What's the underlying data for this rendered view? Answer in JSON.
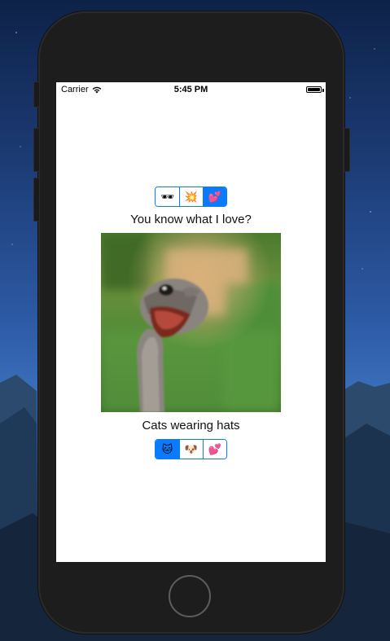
{
  "status_bar": {
    "carrier": "Carrier",
    "time": "5:45 PM",
    "battery_level": 1.0
  },
  "top_segmented_control": {
    "segments": [
      {
        "icon": "sunglasses-emoji",
        "glyph": "🕶",
        "selected": false
      },
      {
        "icon": "collision-emoji",
        "glyph": "💥",
        "selected": false
      },
      {
        "icon": "hearts-emoji",
        "glyph": "💕",
        "selected": true
      }
    ]
  },
  "question_label": "You know what I love?",
  "image": {
    "subject": "ostrich"
  },
  "answer_label": "Cats wearing hats",
  "bottom_segmented_control": {
    "segments": [
      {
        "icon": "cat-face-emoji",
        "glyph": "🐱",
        "selected": true
      },
      {
        "icon": "dog-face-emoji",
        "glyph": "🐶",
        "selected": false
      },
      {
        "icon": "two-hearts-emoji",
        "glyph": "💕",
        "selected": false
      }
    ]
  },
  "colors": {
    "accent": "#0a7aff",
    "device_body": "#1d1d1d",
    "screen_background": "#ffffff"
  }
}
